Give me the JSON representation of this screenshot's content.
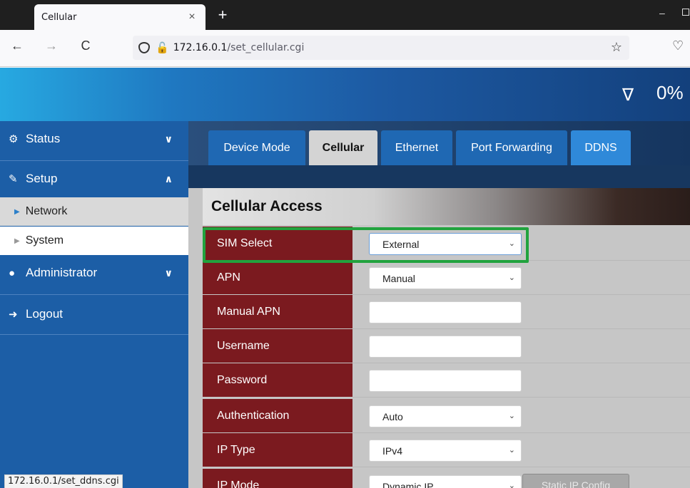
{
  "browser": {
    "tab_title": "Cellular",
    "tab_close": "×",
    "new_tab": "+",
    "url_host": "172.16.0.1",
    "url_path": "/set_cellular.cgi",
    "back": "←",
    "forward": "→",
    "reload": "C",
    "star": "☆",
    "pocket": "♡",
    "minimize": "–",
    "status_url": "172.16.0.1/set_ddns.cgi"
  },
  "header": {
    "filter_icon": "∇",
    "percent": "0%"
  },
  "sidebar": {
    "items": [
      {
        "label": "Status",
        "icon": "⚙",
        "chevron": "∨"
      },
      {
        "label": "Setup",
        "icon": "✎",
        "chevron": "∧"
      },
      {
        "label": "Administrator",
        "icon": "●",
        "chevron": "∨"
      },
      {
        "label": "Logout",
        "icon": "➜"
      }
    ],
    "subitems": [
      {
        "label": "Network",
        "marker": "▶"
      },
      {
        "label": "System",
        "marker": "▶"
      }
    ]
  },
  "tabs": [
    "Device Mode",
    "Cellular",
    "Ethernet",
    "Port Forwarding",
    "DDNS"
  ],
  "panel": {
    "title": "Cellular Access",
    "rows": [
      {
        "label": "SIM Select",
        "type": "select",
        "value": "External"
      },
      {
        "label": "APN",
        "type": "select",
        "value": "Manual"
      },
      {
        "label": "Manual APN",
        "type": "text",
        "value": ""
      },
      {
        "label": "Username",
        "type": "text",
        "value": ""
      },
      {
        "label": "Password",
        "type": "text",
        "value": ""
      },
      {
        "label": "Authentication",
        "type": "select",
        "value": "Auto"
      },
      {
        "label": "IP Type",
        "type": "select",
        "value": "IPv4"
      },
      {
        "label": "IP Mode",
        "type": "select",
        "value": "Dynamic IP",
        "button": "Static IP Config"
      }
    ],
    "select_arrow": "⌄"
  },
  "colors": {
    "label_bg": "#7b1a1f",
    "highlight": "#21a33e",
    "sidebar_bg": "#1c5ea6"
  }
}
